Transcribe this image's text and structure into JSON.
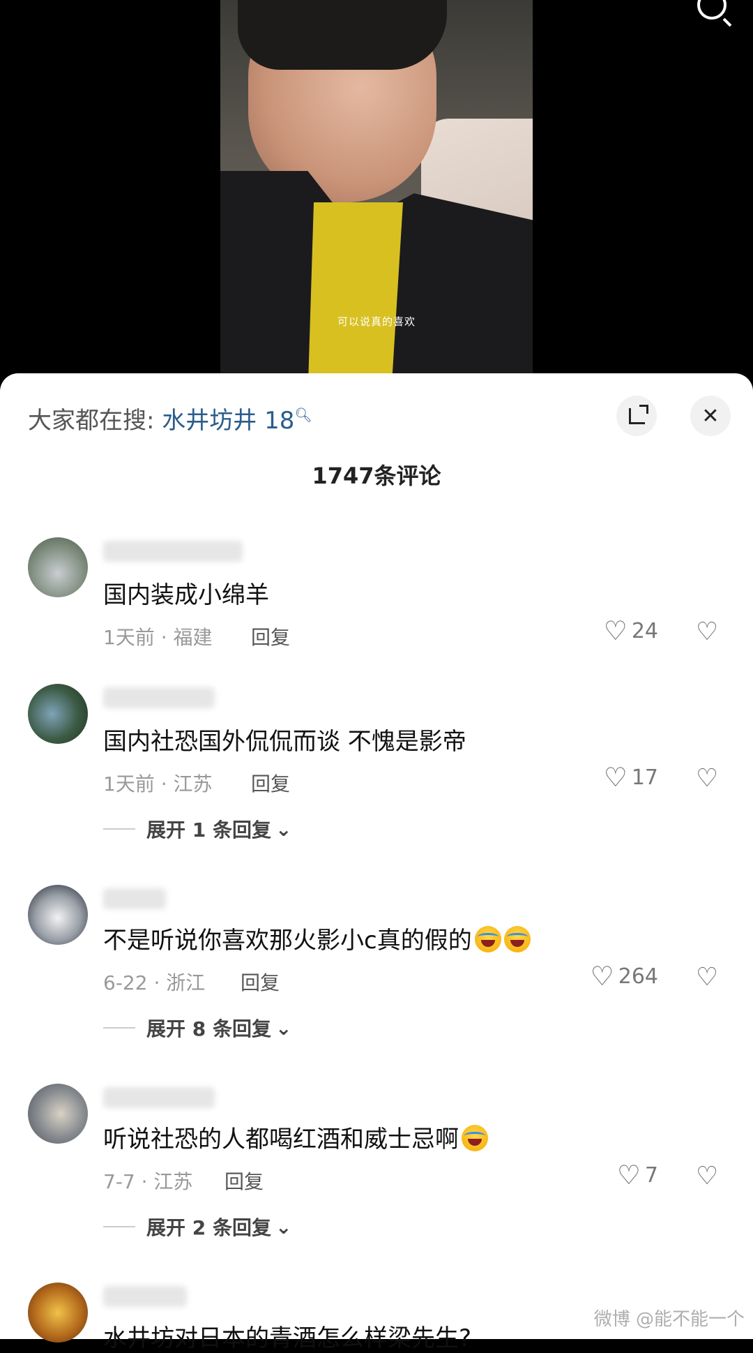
{
  "video": {
    "subtitle": "可以说真的喜欢"
  },
  "sheet": {
    "hot_search_label": "大家都在搜:",
    "hot_search_term": "水井坊井 18",
    "comment_count": "1747条评论"
  },
  "comments": [
    {
      "username": "",
      "text": "国内装成小绵羊",
      "date_location": "1天前 · 福建",
      "reply": "回复",
      "likes": "24",
      "expand": ""
    },
    {
      "username": "",
      "text": "国内社恐国外侃侃而谈 不愧是影帝",
      "date_location": "1天前 · 江苏",
      "reply": "回复",
      "likes": "17",
      "expand": "展开 1 条回复"
    },
    {
      "username": "",
      "text": "不是听说你喜欢那火影小c真的假的",
      "date_location": "6-22 · 浙江",
      "reply": "回复",
      "likes": "264",
      "expand": "展开 8 条回复"
    },
    {
      "username": "",
      "text": "听说社恐的人都喝红酒和威士忌啊",
      "date_location": "7-7 · 江苏",
      "reply": "回复",
      "likes": "7",
      "expand": "展开 2 条回复"
    },
    {
      "username": "",
      "text": "水井坊对日本的青酒怎么样梁先生?",
      "date_location": "",
      "reply": "",
      "likes": "",
      "expand": ""
    }
  ],
  "watermark": "微博 @能不能一个",
  "icons": {
    "search": "search-icon",
    "expand": "expand-icon",
    "close": "close-icon",
    "like": "heart-icon",
    "dislike": "broken-heart-icon",
    "chevron": "chevron-down-icon"
  }
}
